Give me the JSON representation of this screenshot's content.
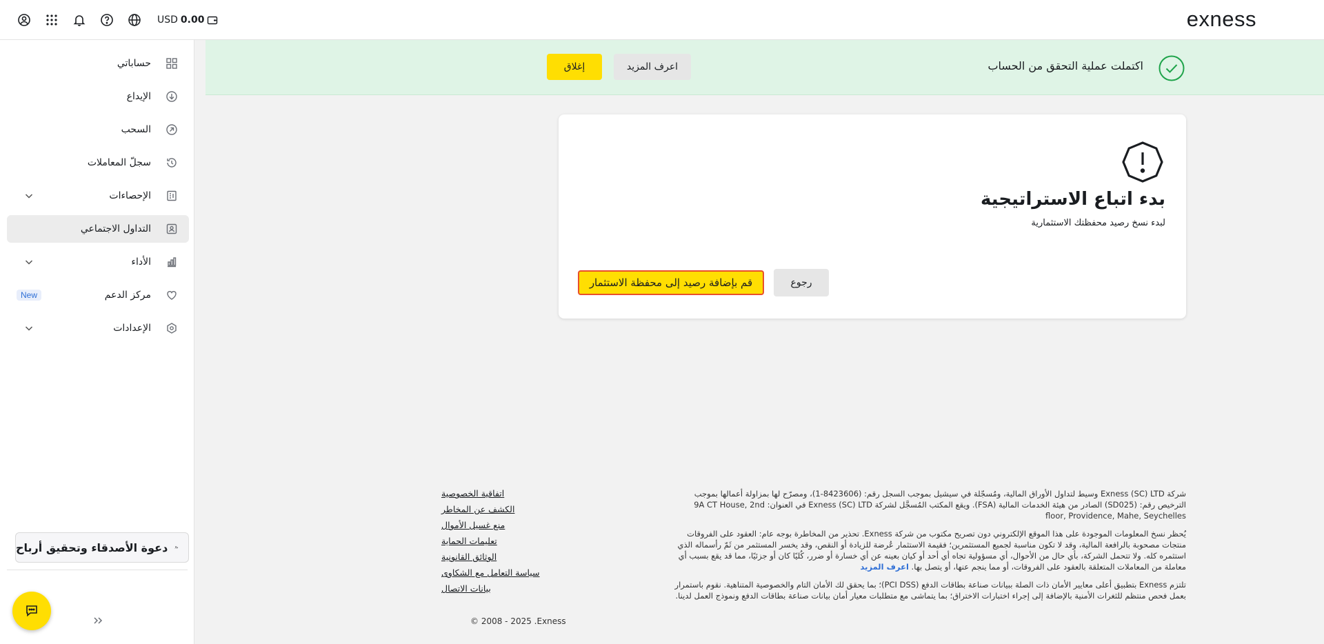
{
  "header": {
    "currency": "USD",
    "balance": "0.00",
    "logo": "exness",
    "icons": [
      "user-circle-icon",
      "apps-grid-icon",
      "bell-icon",
      "help-icon",
      "globe-icon",
      "wallet-icon"
    ]
  },
  "sidebar": {
    "items": [
      {
        "label": "حساباتي",
        "icon": "dashboard-icon"
      },
      {
        "label": "الإيداع",
        "icon": "deposit-icon"
      },
      {
        "label": "السحب",
        "icon": "withdraw-icon"
      },
      {
        "label": "سجلّ المعاملات",
        "icon": "history-icon"
      },
      {
        "label": "الإحصاءات",
        "icon": "statistics-icon",
        "expandable": true
      },
      {
        "label": "التداول الاجتماعي",
        "icon": "social-trading-icon",
        "active": true
      },
      {
        "label": "الأداء",
        "icon": "performance-icon",
        "expandable": true
      },
      {
        "label": "مركز الدعم",
        "icon": "heart-icon",
        "badge": "New"
      },
      {
        "label": "الإعدادات",
        "icon": "settings-icon",
        "expandable": true
      }
    ],
    "invite_label": "دعوة الأصدقاء وتحقيق أرباح"
  },
  "banner": {
    "message": "اكتملت عملية التحقق من الحساب",
    "learn_more": "اعرف المزيد",
    "close": "إغلاق"
  },
  "card": {
    "title": "بدء اتباع الاستراتيجية",
    "subtitle": "لبدء نسخ رصيد محفظتك الاستثمارية",
    "back": "رجوع",
    "add_funds": "قم بإضافة رصيد إلى محفظة الاستثمار"
  },
  "footer": {
    "legal_1": "شركة Exness (SC) LTD وسيط لتداول الأوراق المالية، ومُسجّلة في سيشيل بموجب السجل رقم: (8423606-1)، ومصرّح لها بمزاولة أعمالها بموجب الترخيص رقم: (SD025) الصادر من هيئة الخدمات المالية (FSA). ويقع المكتب المُسجَّل لشركة Exness (SC) LTD في العنوان: 9A CT House, 2nd floor, Providence, Mahe, Seychelles",
    "legal_2": "يُحظر نسخ المعلومات الموجودة على هذا الموقع الإلكتروني دون تصريح مكتوب من شركة Exness. تحذير من المخاطرة بوجه عام: العقود على الفروقات منتجات مصحوبة بالرافعة المالية، وقد لا تكون مناسبة لجميع المستثمرين؛ فقيمة الاستثمار عُرضة للزيادة أو النقص، وقد يخسر المستثمر من ثَمّ رأسماله الذي استثمره كله. ولا تتحمل الشركة، بأي حال من الأحوال، أي مسؤولية تجاه أي أحد أو كيان بعينه عن أي خسارة أو ضرر، كُليًا كان أو جزئيًا، مما قد يقع بسبب أي معاملة من المعاملات المتعلقة بالعقود على الفروقات، أو مما ينجم عنها، أو يتصل بها.",
    "learn_more_link": "اعرف المزيد",
    "legal_3": "تلتزم Exness بتطبيق أعلى معايير الأمان ذات الصلة ببيانات صناعة بطاقات الدفع (PCI DSS)؛ بما يحقق لك الأمان التام والخصوصية المتناهية. نقوم باستمرار بعمل فحص منتظم للثغرات الأمنية بالإضافة إلى إجراء اختبارات الاختراق؛ بما يتماشى مع متطلبات معيار أمان بيانات صناعة بطاقات الدفع ونموذج العمل لدينا.",
    "links": [
      "اتفاقية الخصوصية",
      "الكشف عن المخاطر",
      "منع غسيل الأموال",
      "تعليمات الحماية",
      "الوثائق القانونية",
      "سياسة التعامل مع الشكاوى",
      "بيانات الاتصال"
    ],
    "copyright": "© 2008 - 2025 .Exness"
  }
}
